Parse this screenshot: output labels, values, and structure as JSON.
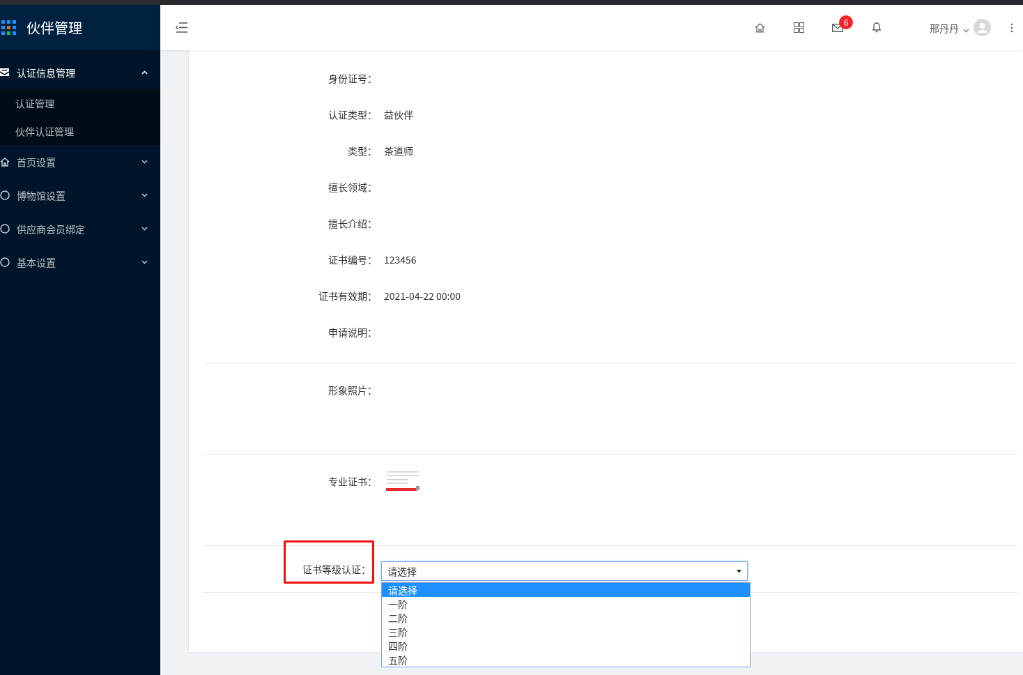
{
  "sidebar": {
    "title": "伙伴管理",
    "menu": [
      {
        "label": "认证信息管理",
        "expanded": true,
        "children": [
          {
            "label": "认证管理",
            "selected": false
          },
          {
            "label": "伙伴认证管理",
            "selected": false
          }
        ]
      },
      {
        "label": "首页设置",
        "expanded": false
      },
      {
        "label": "博物馆设置",
        "expanded": false
      },
      {
        "label": "供应商会员绑定",
        "expanded": false
      },
      {
        "label": "基本设置",
        "expanded": false
      }
    ]
  },
  "header": {
    "mail_count": "6",
    "user": "邢丹丹"
  },
  "form": {
    "fields": [
      {
        "label": "身份证号："
      },
      {
        "label": "认证类型：",
        "value": "益伙伴"
      },
      {
        "label": "类型：",
        "value": "茶道师"
      },
      {
        "label": "擅长领域："
      },
      {
        "label": "擅长介绍："
      },
      {
        "label": "证书编号：",
        "value": "123456"
      },
      {
        "label": "证书有效期：",
        "value": "2021-04-22 00:00"
      },
      {
        "label": "申请说明："
      }
    ],
    "photo": {
      "label": "形象照片："
    },
    "certificate": {
      "label": "专业证书：",
      "kind": "picture"
    },
    "grade": {
      "label": "证书等级认证：",
      "highlighted": true,
      "expanded": true,
      "value": "请选择",
      "options": [
        {
          "label": "请选择",
          "selected": true
        },
        {
          "label": "一阶",
          "selected": false
        },
        {
          "label": "二阶",
          "selected": false
        },
        {
          "label": "三阶",
          "selected": false
        },
        {
          "label": "四阶",
          "selected": false
        },
        {
          "label": "五阶",
          "selected": false
        }
      ]
    }
  }
}
